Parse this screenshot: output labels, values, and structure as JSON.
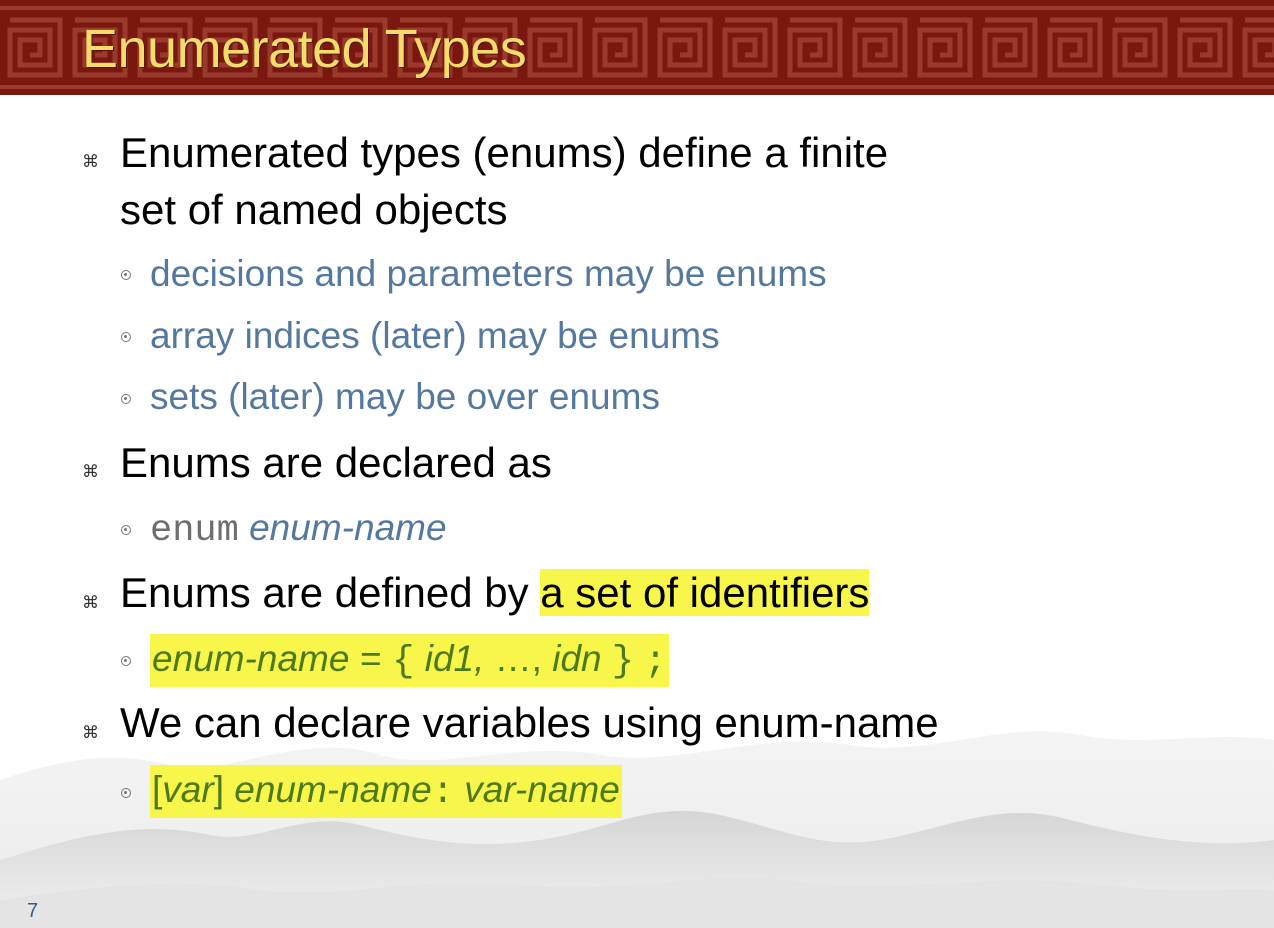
{
  "slide": {
    "title": "Enumerated Types",
    "page_number": "7",
    "bullet_glyph": "⌘",
    "colors": {
      "header_bg": "#7a1810",
      "title": "#f2dd6a",
      "sub_text": "#54789e",
      "highlight": "#f8f54b",
      "code_green": "#4d7a1a"
    }
  },
  "bullets": {
    "b1_line1": "Enumerated types (enums) define a finite",
    "b1_line2": "set of named objects",
    "b1_sub1": "decisions and parameters may be enums",
    "b1_sub2": "array indices (later) may be enums",
    "b1_sub3": "sets (later) may be over enums",
    "b2": "Enums are declared as",
    "b2_sub_kw": "enum",
    "b2_sub_name": "enum-name",
    "b3_prefix": "Enums are defined by",
    "b3_highlight": "a set of identifiers",
    "b3_sub_name": "enum-name",
    "b3_sub_eq": "=",
    "b3_sub_open": "{",
    "b3_sub_id1": "id1,",
    "b3_sub_dots": "…,",
    "b3_sub_idn": "idn",
    "b3_sub_close": "}",
    "b3_sub_semi": ";",
    "b4": "We can declare variables using enum-name",
    "b4_sub_open": "[",
    "b4_sub_var": "var",
    "b4_sub_close": "]",
    "b4_sub_name": "enum-name",
    "b4_sub_colon": ":",
    "b4_sub_varname": "var-name"
  }
}
